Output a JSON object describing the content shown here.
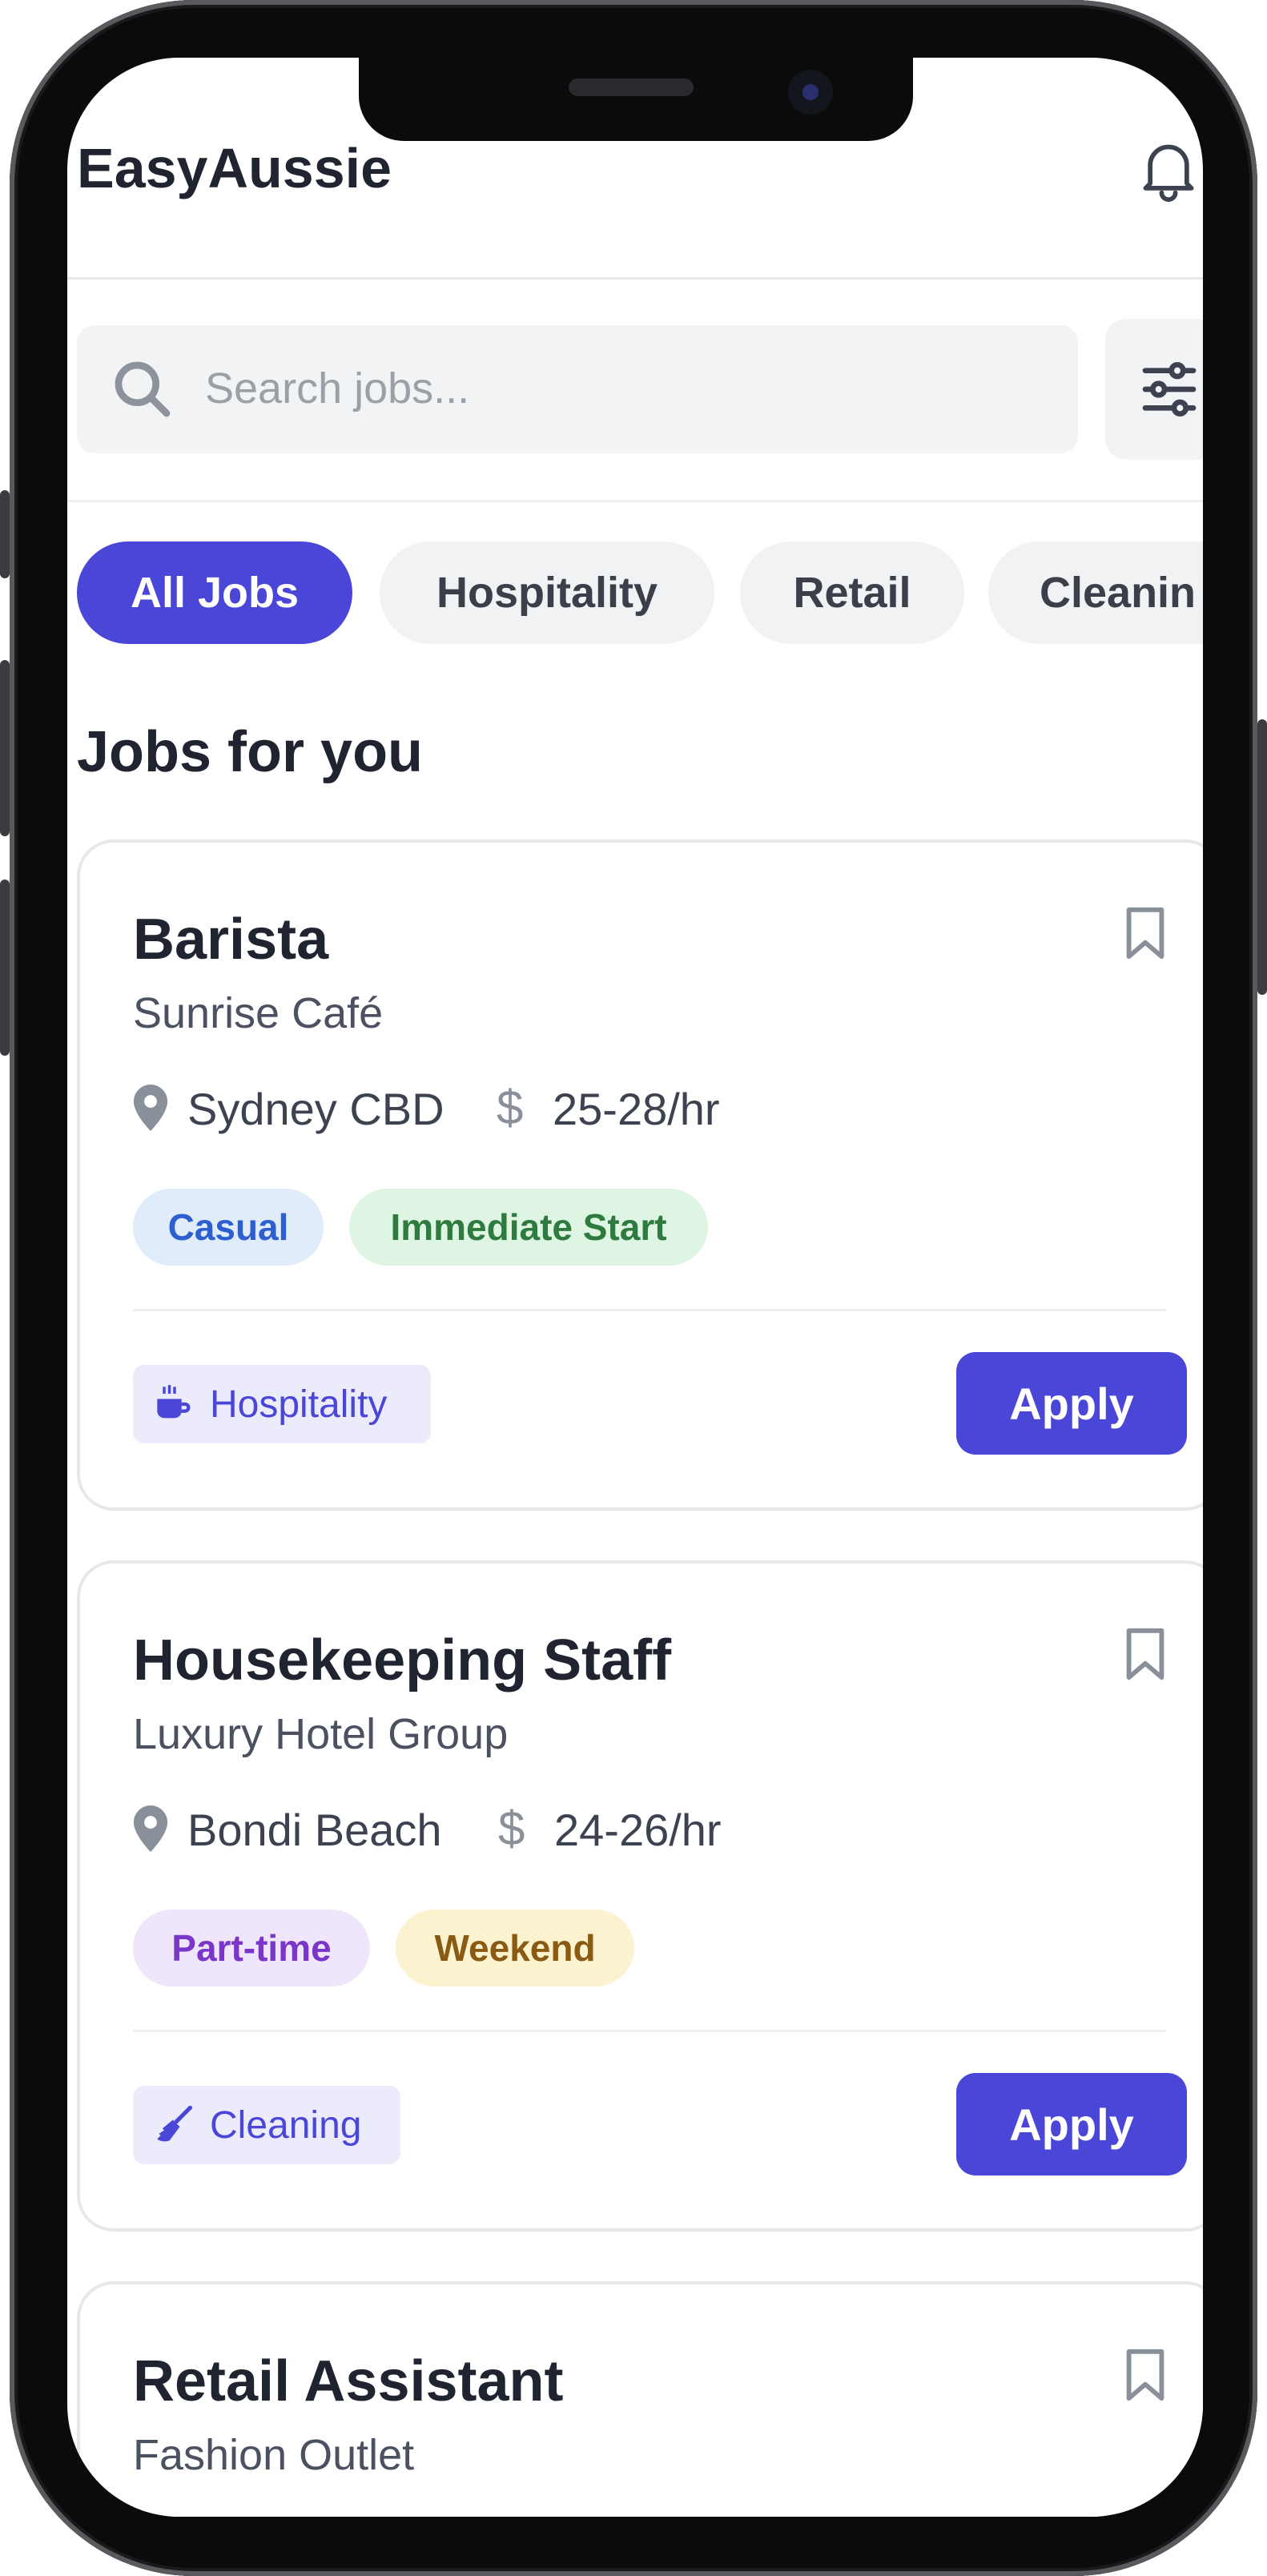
{
  "app": {
    "title": "EasyAussie",
    "notification_icon": "bell-icon"
  },
  "search": {
    "placeholder": "Search jobs...",
    "icon": "search-icon",
    "filter_icon": "sliders-icon"
  },
  "categories": [
    {
      "label": "All Jobs",
      "active": true
    },
    {
      "label": "Hospitality",
      "active": false
    },
    {
      "label": "Retail",
      "active": false
    },
    {
      "label": "Cleanin",
      "active": false
    }
  ],
  "section_title": "Jobs for you",
  "jobs": [
    {
      "title": "Barista",
      "company": "Sunrise Café",
      "location": "Sydney CBD",
      "pay": "25-28/hr",
      "tags": [
        "Casual",
        "Immediate Start"
      ],
      "category": "Hospitality",
      "category_icon": "coffee-icon",
      "apply_label": "Apply"
    },
    {
      "title": "Housekeeping Staff",
      "company": "Luxury Hotel Group",
      "location": "Bondi Beach",
      "pay": "24-26/hr",
      "tags": [
        "Part-time",
        "Weekend"
      ],
      "category": "Cleaning",
      "category_icon": "broom-icon",
      "apply_label": "Apply"
    },
    {
      "title": "Retail Assistant",
      "company": "Fashion Outlet"
    }
  ],
  "currency_symbol": "$",
  "colors": {
    "accent": "#4a46d8",
    "tag_casual_bg": "#e1ecfb",
    "tag_casual_fg": "#2d5fd0",
    "tag_immediate_bg": "#dff5e4",
    "tag_immediate_fg": "#2f7a3f",
    "tag_parttime_bg": "#efe6fb",
    "tag_parttime_fg": "#7a35c9",
    "tag_weekend_bg": "#fbf3cf",
    "tag_weekend_fg": "#8a5a12"
  }
}
